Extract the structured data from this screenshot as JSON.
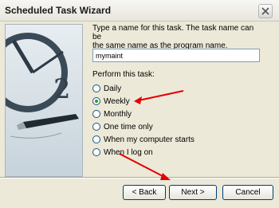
{
  "window": {
    "title": "Scheduled Task Wizard"
  },
  "content": {
    "intro_line1": "Type a name for this task.  The task name can be",
    "intro_line2": "the same name as the program name.",
    "task_name_value": "mymaint",
    "perform_label": "Perform this task:",
    "radio_options": [
      "Daily",
      "Weekly",
      "Monthly",
      "One time only",
      "When my computer starts",
      "When I log on"
    ],
    "selected_index": 1
  },
  "buttons": {
    "back": "< Back",
    "next": "Next >",
    "cancel": "Cancel"
  },
  "colors": {
    "titlebar": "#f6f6f3",
    "window_bg": "#ece9d8",
    "arrow": "#e20000"
  },
  "icons": [
    "close-icon",
    "clock-pen-illustration",
    "red-arrow-annotation"
  ]
}
